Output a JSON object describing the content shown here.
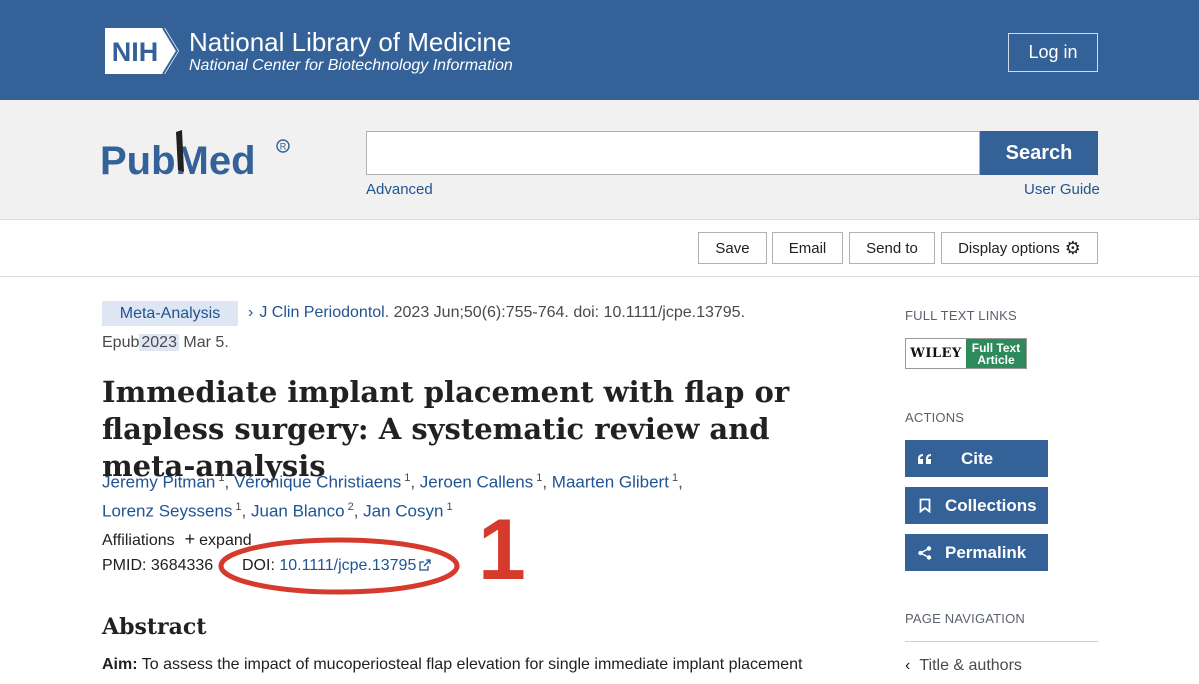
{
  "header": {
    "logo_text": "NIH",
    "title": "National Library of Medicine",
    "subtitle": "National Center for Biotechnology Information",
    "login_label": "Log in"
  },
  "search": {
    "logo_text": "PubMed",
    "placeholder": "",
    "value": "",
    "button_label": "Search",
    "advanced_link": "Advanced",
    "user_guide_link": "User Guide"
  },
  "toolbar": {
    "save": "Save",
    "email": "Email",
    "send_to": "Send to",
    "display_options": "Display options"
  },
  "article": {
    "type": "Meta-Analysis",
    "journal": "J Clin Periodontol.",
    "citation": "2023 Jun;50(6):755-764. doi: 10.1111/jcpe.13795.",
    "epub_prefix": "Epub",
    "epub_year": "2023",
    "epub_suffix": "Mar 5.",
    "title": "Immediate implant placement with flap or flapless surgery: A systematic review and meta-analysis",
    "authors": [
      {
        "name": "Jeremy Pitman",
        "aff": "1"
      },
      {
        "name": "Véronique Christiaens",
        "aff": "1"
      },
      {
        "name": "Jeroen Callens",
        "aff": "1"
      },
      {
        "name": "Maarten Glibert",
        "aff": "1"
      },
      {
        "name": "Lorenz Seyssens",
        "aff": "1"
      },
      {
        "name": "Juan Blanco",
        "aff": "2"
      },
      {
        "name": "Jan Cosyn",
        "aff": "1"
      }
    ],
    "affiliations_label": "Affiliations",
    "expand_label": "expand",
    "pmid_label": "PMID: 3684336",
    "doi_label": "DOI:",
    "doi_value": "10.1111/jcpe.13795",
    "annotation_number": "1",
    "abstract_heading": "Abstract",
    "aim_label": "Aim:",
    "aim_text": "To assess the impact of mucoperiosteal flap elevation for single immediate implant placement"
  },
  "sidebar": {
    "full_text_heading": "FULL TEXT LINKS",
    "wiley_brand": "WILEY",
    "wiley_line1": "Full Text",
    "wiley_line2": "Article",
    "actions_heading": "ACTIONS",
    "cite": "Cite",
    "collections": "Collections",
    "permalink": "Permalink",
    "page_nav_heading": "PAGE NAVIGATION",
    "nav_title_authors": "Title & authors"
  },
  "colors": {
    "brand_blue": "#336198",
    "link_blue": "#205493",
    "annotation_red": "#d63a2c",
    "wiley_green": "#2d8a5a"
  },
  "icons": [
    "nih-logo",
    "pubmed-logo",
    "gear-icon",
    "plus-icon",
    "external-link-icon",
    "quote-icon",
    "bookmark-icon",
    "share-icon",
    "chevron-left-icon",
    "chevron-right-icon"
  ]
}
